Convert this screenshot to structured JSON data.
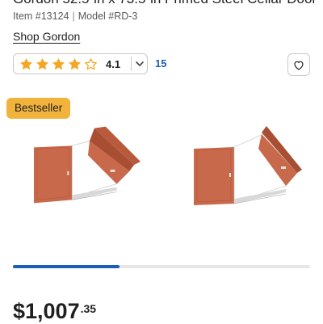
{
  "product": {
    "title": "Gordon 52.5-in x 73.5-in Primed Steel Cellar Door",
    "item_label": "Item #13124",
    "model_label": "Model #RD-3",
    "separator": "|",
    "brand_link": "Shop Gordon"
  },
  "rating": {
    "value": "4.1",
    "stars": [
      "star-full-icon",
      "star-full-icon",
      "star-full-icon",
      "star-full-icon",
      "star-outline-icon"
    ],
    "review_count": "15",
    "star_color": "#f5a623"
  },
  "badge": {
    "label": "Bestseller",
    "color": "#f2b33d"
  },
  "gallery": {
    "progress_fraction": 0.36,
    "accent_color": "#1a5fb4"
  },
  "price": {
    "dollars": "$1,007",
    "cents": ".35"
  },
  "icons": {
    "chevron": "chevron-down-icon",
    "favorite": "heart-icon"
  }
}
